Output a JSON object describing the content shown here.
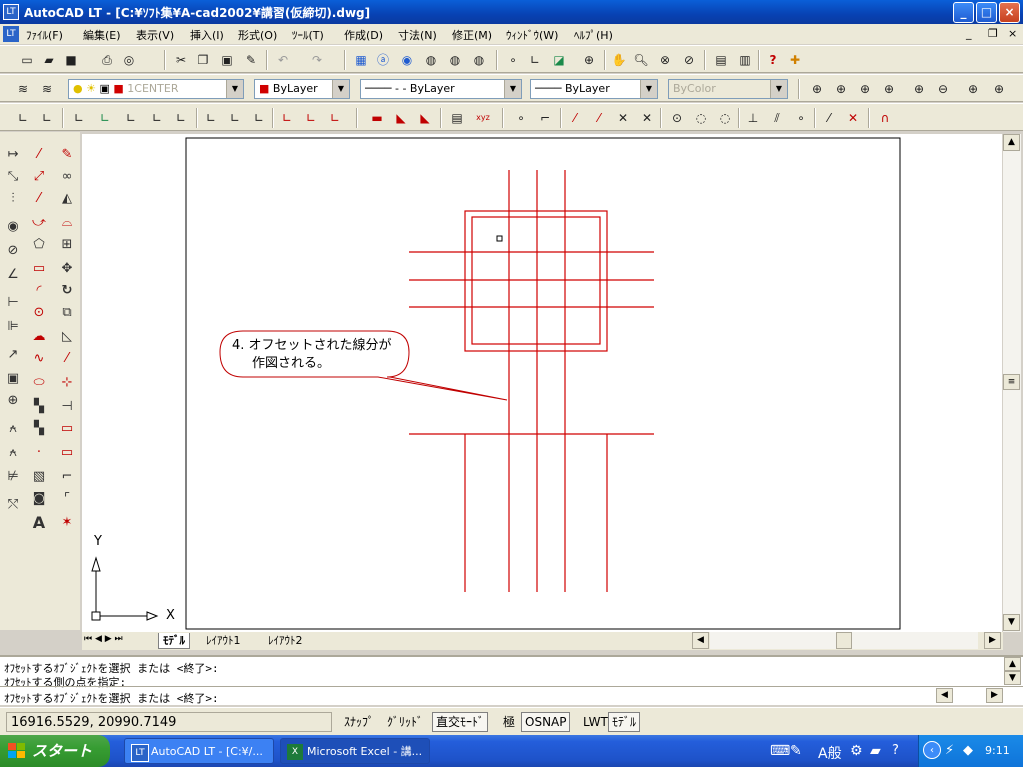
{
  "window": {
    "app_icon": "LT",
    "title": "AutoCAD LT - [C:¥ｿﾌﾄ集¥A-cad2002¥講習(仮締切).dwg]",
    "minimize": "_",
    "maximize": "□",
    "close": "×"
  },
  "menubar": {
    "items": [
      "ﾌｧｲﾙ(F)",
      "編集(E)",
      "表示(V)",
      "挿入(I)",
      "形式(O)",
      "ﾂｰﾙ(T)",
      "作成(D)",
      "寸法(N)",
      "修正(M)",
      "ｳｨﾝﾄﾞｳ(W)",
      "ﾍﾙﾌﾟ(H)"
    ],
    "doc_controls": [
      "_",
      "❐",
      "×"
    ]
  },
  "toolbars": {
    "layer_name": "1CENTER",
    "color": "ByLayer",
    "linetype": "ByLayer",
    "lineweight": "ByLayer",
    "plotstyle": "ByColor",
    "color_accent": "#d00000"
  },
  "drawing": {
    "callout_line1": "4. オフセットされた線分が",
    "callout_line2": "作図される。",
    "ucs_x": "X",
    "ucs_y": "Y",
    "line_color": "#d00000"
  },
  "tabs": [
    "ﾓﾃﾞﾙ",
    "ﾚｲｱｳﾄ1",
    "ﾚｲｱｳﾄ2"
  ],
  "command": {
    "line1": "ｵﾌｾｯﾄするｵﾌﾞｼﾞｪｸﾄを選択 または <終了>:",
    "line2": "ｵﾌｾｯﾄする側の点を指定:",
    "line3": "ｵﾌｾｯﾄするｵﾌﾞｼﾞｪｸﾄを選択 または <終了>:"
  },
  "status": {
    "coords": "16916.5529, 20990.7149",
    "toggles": [
      {
        "label": "ｽﾅｯﾌﾟ",
        "on": false
      },
      {
        "label": "ｸﾞﾘｯﾄﾞ",
        "on": false
      },
      {
        "label": "直交ﾓｰﾄﾞ",
        "on": true
      },
      {
        "label": "極",
        "on": false
      },
      {
        "label": "OSNAP",
        "on": true
      },
      {
        "label": "LWT",
        "on": false
      },
      {
        "label": "ﾓﾃﾞﾙ",
        "on": true
      }
    ]
  },
  "taskbar": {
    "start": "スタート",
    "tasks": [
      {
        "label": "AutoCAD LT - [C:¥/...",
        "icon": "LT"
      },
      {
        "label": "Microsoft Excel - 講...",
        "icon": "X"
      }
    ],
    "ime": "A般",
    "clock": "9:11"
  }
}
